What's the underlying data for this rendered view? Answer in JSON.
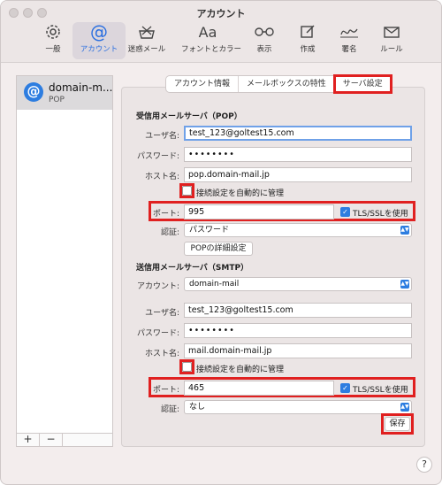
{
  "window": {
    "title": "アカウント"
  },
  "toolbar": [
    {
      "label": "一般",
      "icon": "gear-icon"
    },
    {
      "label": "アカウント",
      "icon": "at-icon"
    },
    {
      "label": "迷惑メール",
      "icon": "junk-tray-icon"
    },
    {
      "label": "フォントとカラー",
      "icon": "font-aa-icon"
    },
    {
      "label": "表示",
      "icon": "glasses-icon"
    },
    {
      "label": "作成",
      "icon": "compose-icon"
    },
    {
      "label": "署名",
      "icon": "signature-icon"
    },
    {
      "label": "ルール",
      "icon": "rules-envelope-icon"
    }
  ],
  "sidebar": {
    "account": {
      "name": "domain-m...",
      "type": "POP"
    },
    "add_label": "+",
    "remove_label": "−"
  },
  "tabs": [
    "アカウント情報",
    "メールボックスの特性",
    "サーバ設定"
  ],
  "incoming": {
    "heading": "受信用メールサーバ（POP）",
    "username_label": "ユーザ名:",
    "username": "test_123@goltest15.com",
    "password_label": "パスワード:",
    "password": "••••••••",
    "host_label": "ホスト名:",
    "host": "pop.domain-mail.jp",
    "auto_manage_label": "接続設定を自動的に管理",
    "port_label": "ポート:",
    "port": "995",
    "tls_label": "TLS/SSLを使用",
    "auth_label": "認証:",
    "auth": "パスワード",
    "advanced_button": "POPの詳細設定"
  },
  "outgoing": {
    "heading": "送信用メールサーバ（SMTP）",
    "account_label": "アカウント:",
    "account": "domain-mail",
    "username_label": "ユーザ名:",
    "username": "test_123@goltest15.com",
    "password_label": "パスワード:",
    "password": "••••••••",
    "host_label": "ホスト名:",
    "host": "mail.domain-mail.jp",
    "auto_manage_label": "接続設定を自動的に管理",
    "port_label": "ポート:",
    "port": "465",
    "tls_label": "TLS/SSLを使用",
    "auth_label": "認証:",
    "auth": "なし"
  },
  "save_button": "保存",
  "help_button": "?",
  "colors": {
    "accent": "#2d7de0",
    "highlight": "#e02020"
  }
}
